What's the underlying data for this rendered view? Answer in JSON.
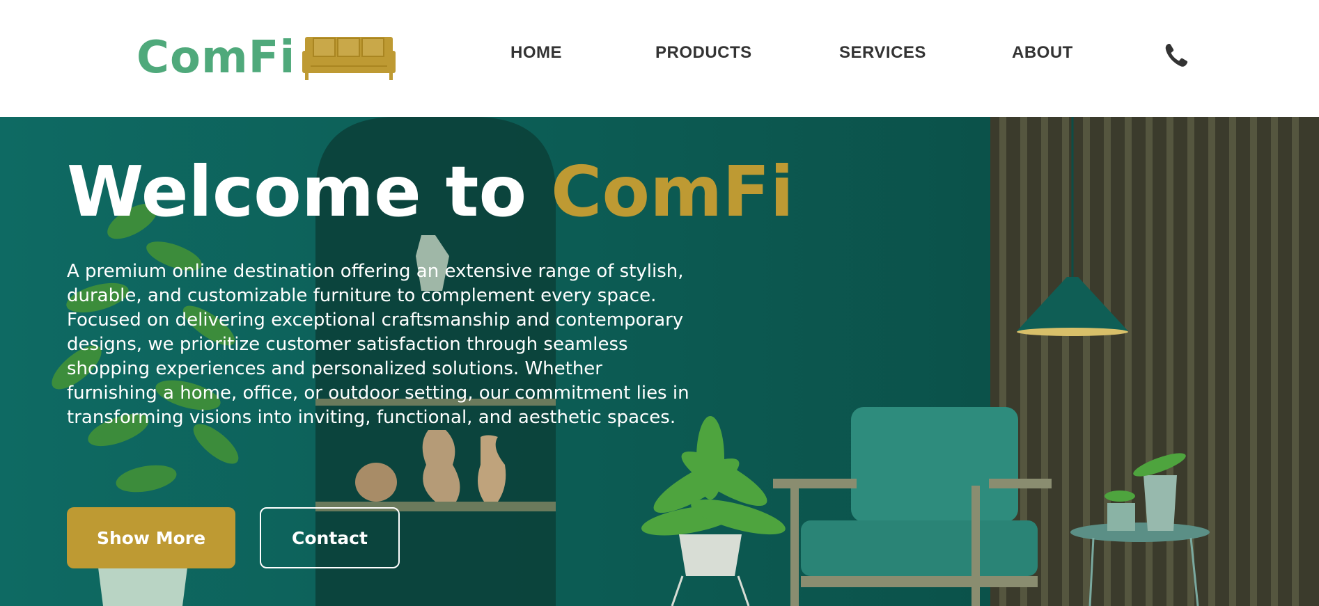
{
  "header": {
    "logo_text": "ComFi",
    "logo_icon": "sofa-icon",
    "nav": [
      {
        "label": "HOME"
      },
      {
        "label": "PRODUCTS"
      },
      {
        "label": "SERVICES"
      },
      {
        "label": "ABOUT"
      }
    ],
    "phone_icon": "phone-icon"
  },
  "hero": {
    "title_prefix": "Welcome to ",
    "title_brand": "ComFi",
    "description": "A premium online destination offering an extensive range of stylish, durable, and customizable furniture to complement every space. Focused on delivering exceptional craftsmanship and contemporary designs, we prioritize customer satisfaction through seamless shopping experiences and personalized solutions. Whether furnishing a home, office, or outdoor setting, our commitment lies in transforming visions into inviting, functional, and aesthetic spaces.",
    "primary_button": "Show More",
    "secondary_button": "Contact"
  },
  "colors": {
    "brand_green": "#4fa97b",
    "brand_gold": "#be9a33",
    "hero_teal": "#0f5a52",
    "nav_text": "#333333"
  }
}
